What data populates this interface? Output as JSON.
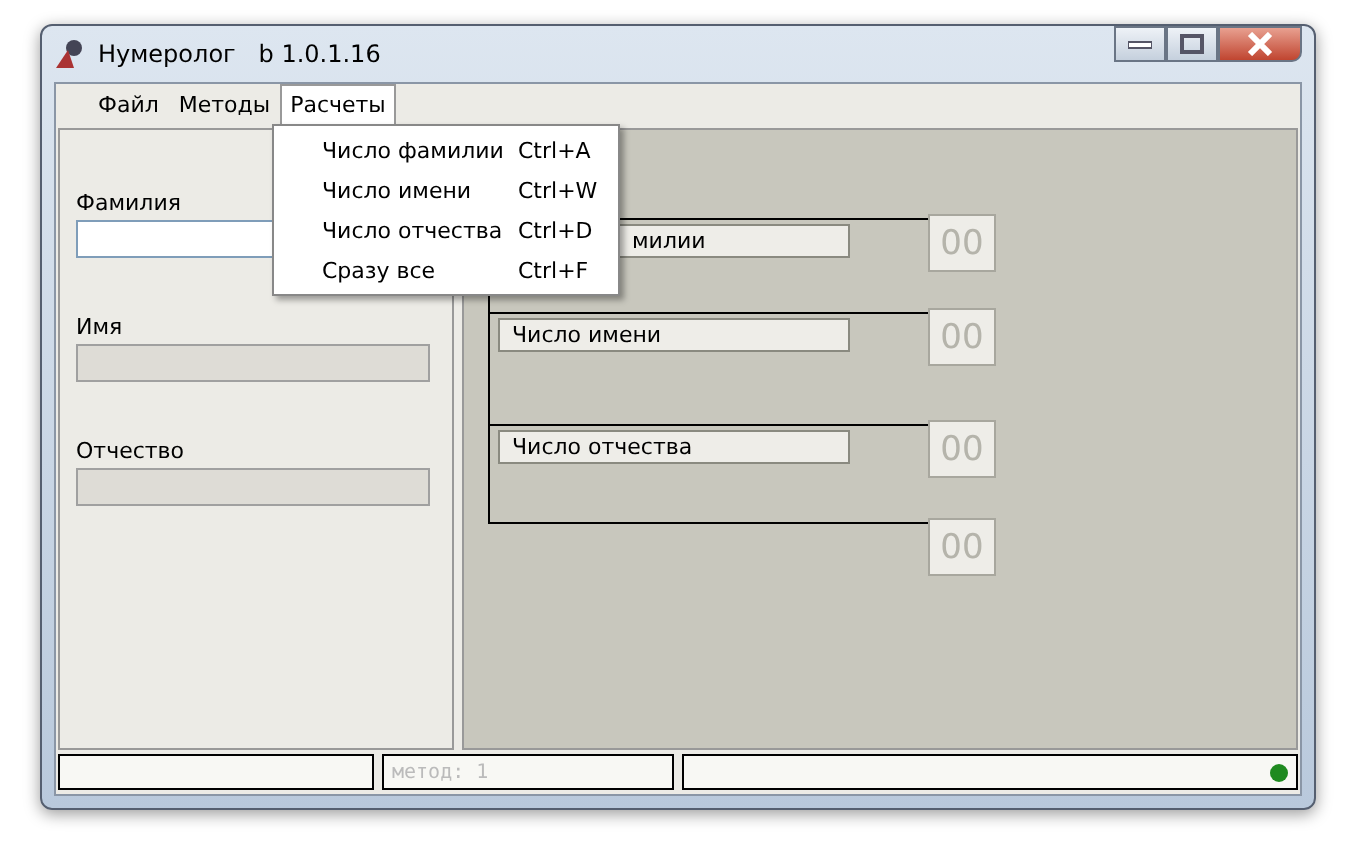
{
  "window": {
    "title": "Нумеролог   b 1.0.1.16"
  },
  "menu_bar": [
    {
      "label": "Файл",
      "selected": false
    },
    {
      "label": "Методы",
      "selected": false
    },
    {
      "label": "Расчеты",
      "selected": true
    }
  ],
  "dropdown": [
    {
      "label": "Число фамилии",
      "shortcut": "Ctrl+A"
    },
    {
      "label": "Число имени",
      "shortcut": "Ctrl+W"
    },
    {
      "label": "Число отчества",
      "shortcut": "Ctrl+D"
    },
    {
      "label": "Сразу все",
      "shortcut": "Ctrl+F"
    }
  ],
  "inputs": [
    {
      "label": "Фамилия",
      "disabled": false
    },
    {
      "label": "Имя",
      "disabled": true
    },
    {
      "label": "Отчество",
      "disabled": true
    }
  ],
  "results": [
    {
      "label": "милии",
      "covered": true,
      "value": "00",
      "disabled": true
    },
    {
      "label": "Число имени",
      "covered": false,
      "value": "00",
      "disabled": true
    },
    {
      "label": "Число отчества",
      "covered": false,
      "value": "00",
      "disabled": true
    }
  ],
  "total": {
    "value": "00",
    "disabled": true
  },
  "status_bar": {
    "method": "метод: 1",
    "indicator_on": true
  }
}
